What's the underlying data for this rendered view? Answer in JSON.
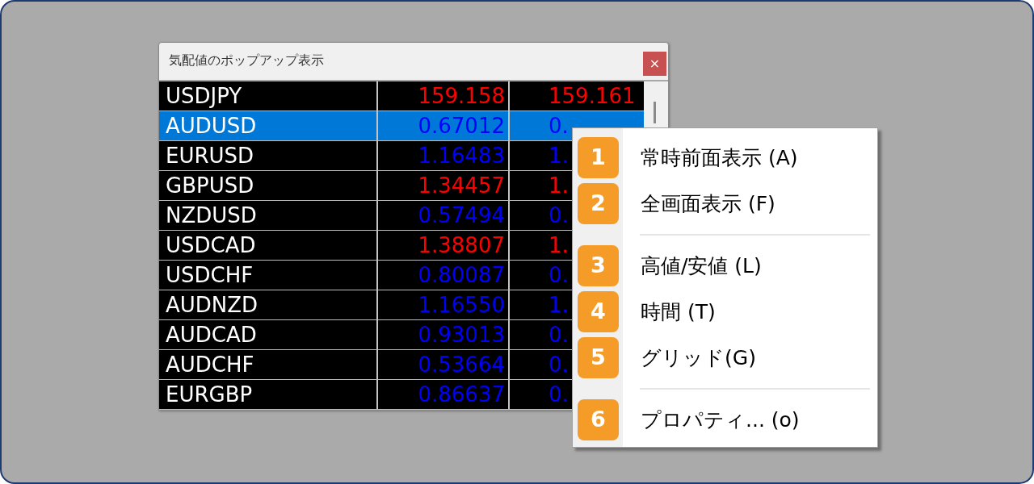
{
  "window": {
    "title": "気配値のポップアップ表示",
    "close_button": {
      "label": "×"
    }
  },
  "table": {
    "rows": [
      {
        "column_1": "USDJPY",
        "column_2": "159.158",
        "column_3": "159.161",
        "color": "#ff0000",
        "selected": false
      },
      {
        "column_1": "AUDUSD",
        "column_2": "0.67012",
        "column_3": "0.",
        "color": "#0000ff",
        "selected": true
      },
      {
        "column_1": "EURUSD",
        "column_2": "1.16483",
        "column_3": "1.",
        "color": "#0000ff",
        "selected": false
      },
      {
        "column_1": "GBPUSD",
        "column_2": "1.34457",
        "column_3": "1.",
        "color": "#ff0000",
        "selected": false
      },
      {
        "column_1": "NZDUSD",
        "column_2": "0.57494",
        "column_3": "0.",
        "color": "#0000ff",
        "selected": false
      },
      {
        "column_1": "USDCAD",
        "column_2": "1.38807",
        "column_3": "1.",
        "color": "#ff0000",
        "selected": false
      },
      {
        "column_1": "USDCHF",
        "column_2": "0.80087",
        "column_3": "0.",
        "color": "#0000ff",
        "selected": false
      },
      {
        "column_1": "AUDNZD",
        "column_2": "1.16550",
        "column_3": "1.",
        "color": "#0000ff",
        "selected": false
      },
      {
        "column_1": "AUDCAD",
        "column_2": "0.93013",
        "column_3": "0.",
        "color": "#0000ff",
        "selected": false
      },
      {
        "column_1": "AUDCHF",
        "column_2": "0.53664",
        "column_3": "0.",
        "color": "#0000ff",
        "selected": false
      },
      {
        "column_1": "EURGBP",
        "column_2": "0.86637",
        "column_3": "0.",
        "color": "#0000ff",
        "selected": false
      }
    ]
  },
  "context_menu": {
    "items": [
      {
        "kind": "item",
        "badge": "1",
        "label": "常時前面表示 (A)"
      },
      {
        "kind": "item",
        "badge": "2",
        "label": "全画面表示 (F)"
      },
      {
        "kind": "separator"
      },
      {
        "kind": "item",
        "badge": "3",
        "label": "高値/安値 (L)"
      },
      {
        "kind": "item",
        "badge": "4",
        "label": "時間 (T)"
      },
      {
        "kind": "item",
        "badge": "5",
        "label": "グリッド(G)"
      },
      {
        "kind": "separator"
      },
      {
        "kind": "item",
        "badge": "6",
        "label": "プロパティ... (o)"
      }
    ]
  }
}
